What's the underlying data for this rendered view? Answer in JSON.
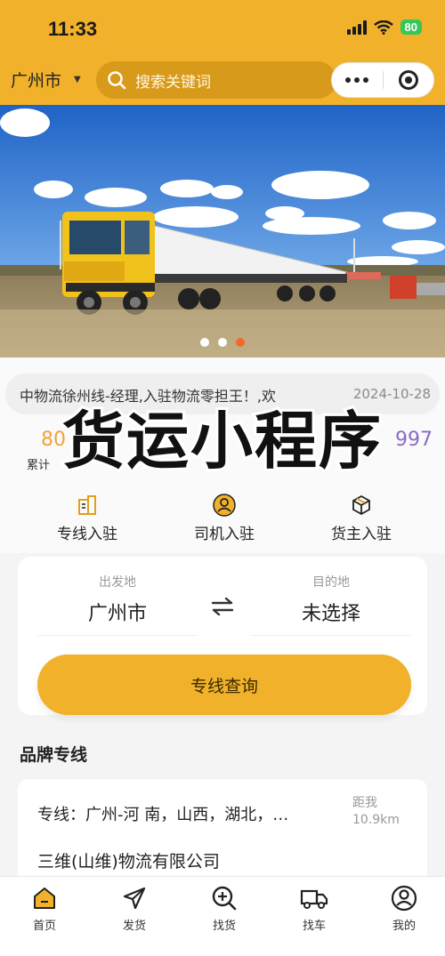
{
  "status": {
    "time": "11:33",
    "battery": "80"
  },
  "header": {
    "city": "广州市",
    "search_placeholder": "搜索关键词"
  },
  "notice": {
    "text": "中物流徐州线-经理,入驻物流零担王！,欢",
    "date": "2024-10-28"
  },
  "stats": [
    {
      "value": "80",
      "label": "累计",
      "color": "#f2a23a"
    },
    {
      "value": "997",
      "label": "",
      "color": "#8a6cc4"
    }
  ],
  "overlay_title": "货运小程序",
  "entries": [
    {
      "label": "专线入驻",
      "icon": "building-icon"
    },
    {
      "label": "司机入驻",
      "icon": "driver-avatar-icon"
    },
    {
      "label": "货主入驻",
      "icon": "box-icon"
    }
  ],
  "route": {
    "origin_caption": "出发地",
    "origin_value": "广州市",
    "dest_caption": "目的地",
    "dest_value": "未选择",
    "query_button": "专线查询"
  },
  "brand": {
    "title": "品牌专线",
    "route_text": "专线：广州-河 南，山西，湖北，…",
    "distance_caption": "距我",
    "distance": "10.9km",
    "company": "三维(山维)物流有限公司"
  },
  "tabs": [
    {
      "label": "首页",
      "icon": "home-icon",
      "active": true
    },
    {
      "label": "发货",
      "icon": "send-icon"
    },
    {
      "label": "找货",
      "icon": "search-goods-icon"
    },
    {
      "label": "找车",
      "icon": "truck-icon"
    },
    {
      "label": "我的",
      "icon": "profile-icon"
    }
  ],
  "colors": {
    "brand": "#f2b12a",
    "accent": "#f26a2a"
  }
}
